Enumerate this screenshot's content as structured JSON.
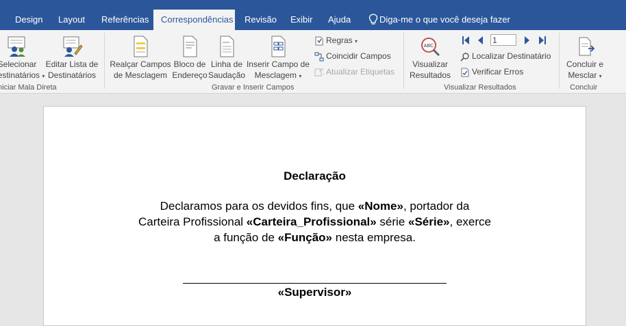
{
  "tabs": [
    "Design",
    "Layout",
    "Referências",
    "Correspondências",
    "Revisão",
    "Exibir",
    "Ajuda"
  ],
  "tell_me": "Diga-me o que você deseja fazer",
  "ribbon": {
    "select_recipients": [
      "Selecionar",
      "Destinatários"
    ],
    "edit_list": [
      "Editar Lista de",
      "Destinatários"
    ],
    "group_start": "Iniciar Mala Direta",
    "highlight_fields": [
      "Realçar Campos",
      "de Mesclagem"
    ],
    "address_block": [
      "Bloco de",
      "Endereço"
    ],
    "greeting_line": [
      "Linha de",
      "Saudação"
    ],
    "insert_field": [
      "Inserir Campo de",
      "Mesclagem"
    ],
    "rules": "Regras",
    "match_fields": "Coincidir Campos",
    "update_labels": "Atualizar Etiquetas",
    "group_write": "Gravar e Inserir Campos",
    "preview": [
      "Visualizar",
      "Resultados"
    ],
    "record_value": "1",
    "find_recipient": "Localizar Destinatário",
    "check_errors": "Verificar Erros",
    "group_preview": "Visualizar Resultados",
    "finish": [
      "Concluir e",
      "Mesclar"
    ],
    "group_finish": "Concluir"
  },
  "document": {
    "title": "Declaração",
    "p1": "Declaramos para os devidos fins, que ",
    "f_nome": "«Nome»",
    "p2": ", portador da",
    "p3": "Carteira Profissional ",
    "f_carteira": "«Carteira_Profissional»",
    "p4": " série ",
    "f_serie": "«Série»",
    "p5": ", exerce",
    "p6": "a função de ",
    "f_funcao": "«Função»",
    "p7": " nesta empresa.",
    "supervisor": "«Supervisor»"
  },
  "colors": {
    "tab_bar": "#2b579a",
    "ribbon": "#f3f3f3",
    "icon_accent": "#2b579a"
  }
}
